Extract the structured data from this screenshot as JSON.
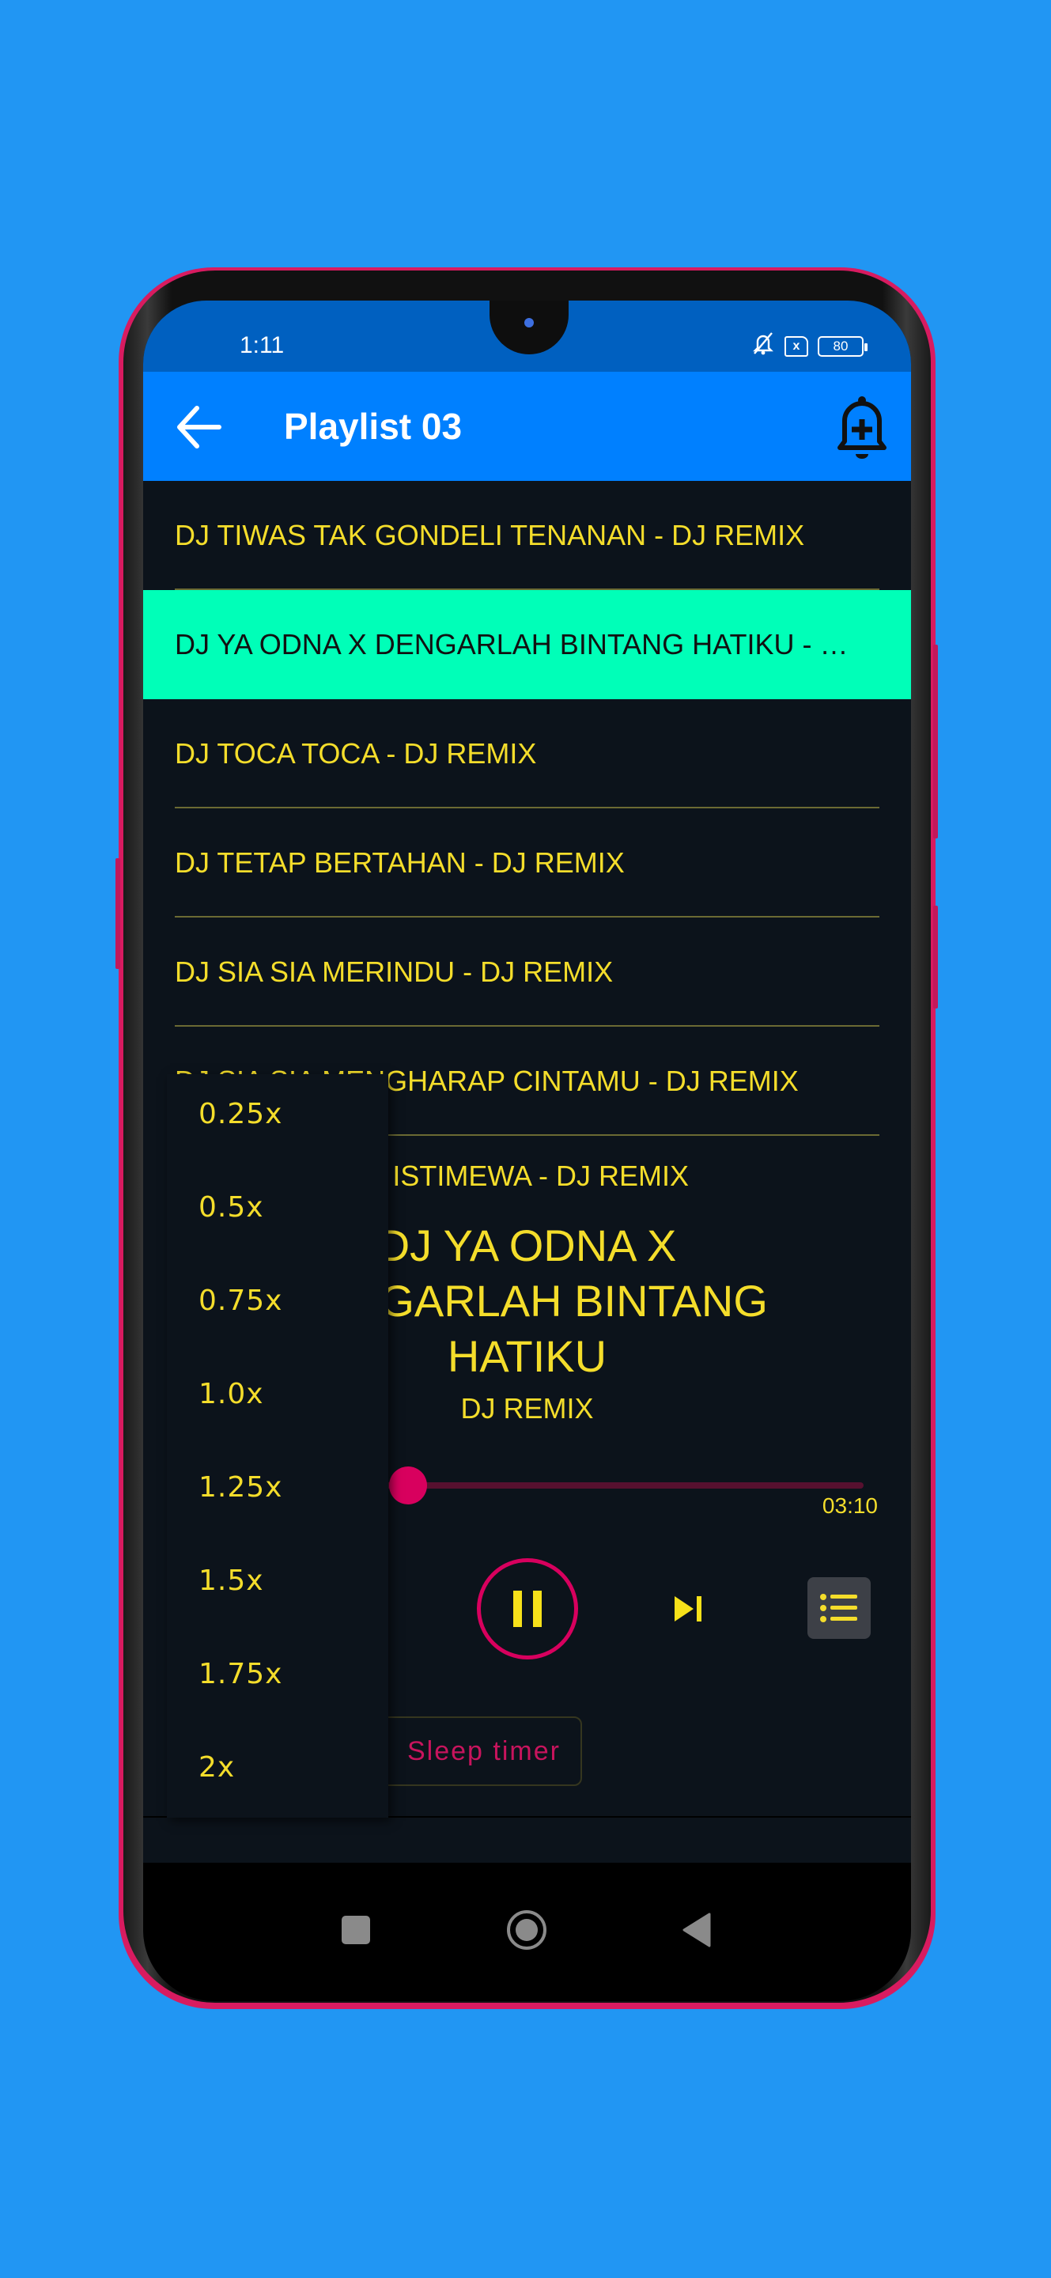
{
  "status_bar": {
    "time": "1:11",
    "icons": [
      "bell-off-icon",
      "sim-error-icon",
      "battery-icon"
    ],
    "sim_glyph": "x",
    "battery_level": "80"
  },
  "app_bar": {
    "title": "Playlist 03",
    "back_icon": "arrow-left-icon",
    "action_icon": "bell-plus-icon"
  },
  "playlist": {
    "items": [
      {
        "label": "DJ TIWAS TAK GONDELI TENANAN - DJ REMIX",
        "active": false
      },
      {
        "label": "DJ YA ODNA X DENGARLAH BINTANG HATIKU - DJ REMIX",
        "active": true
      },
      {
        "label": "DJ TOCA TOCA - DJ REMIX",
        "active": false
      },
      {
        "label": "DJ TETAP BERTAHAN - DJ REMIX",
        "active": false
      },
      {
        "label": "DJ SIA SIA MERINDU - DJ REMIX",
        "active": false
      },
      {
        "label": "DJ SIA SIA MENGHARAP CINTAMU - DJ REMIX",
        "active": false
      },
      {
        "label": "DJ CINTAKU INI ISTIMEWA - DJ REMIX",
        "active": false
      }
    ]
  },
  "now_playing": {
    "title": "DJ YA ODNA X DENGARLAH BINTANG HATIKU",
    "artist": "DJ REMIX",
    "progress_fraction": 0.04,
    "time_total": "03:10"
  },
  "controls": {
    "play_pause_icon": "pause-icon",
    "next_icon": "skip-next-icon",
    "playlist_icon": "list-icon"
  },
  "sleep_timer": {
    "label": "Sleep timer",
    "icon": "moon-icon"
  },
  "speed_menu": {
    "options": [
      "0.25x",
      "0.5x",
      "0.75x",
      "1.0x",
      "1.25x",
      "1.5x",
      "1.75x",
      "2x"
    ]
  },
  "nav_bar": {
    "buttons": [
      "recents-icon",
      "home-icon",
      "back-triangle-icon"
    ]
  },
  "colors": {
    "background": "#2196f3",
    "status_bar": "#0060c0",
    "app_bar": "#0080ff",
    "screen_bg": "#0c131b",
    "text_yellow": "#f4dd2b",
    "active_row": "#00ffb8",
    "accent_pink": "#d8005e"
  }
}
